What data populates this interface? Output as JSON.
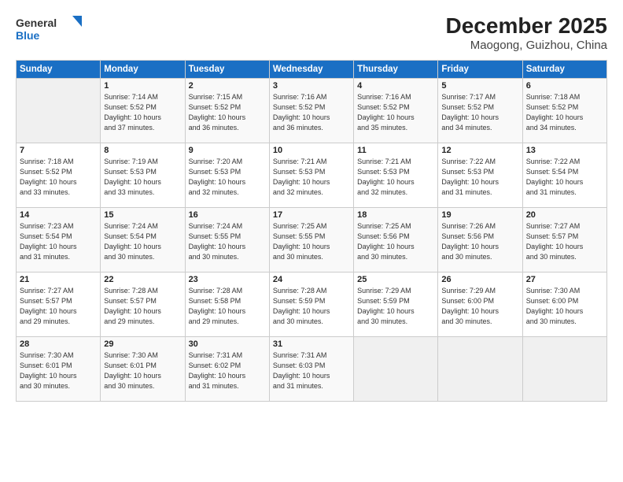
{
  "header": {
    "logo_general": "General",
    "logo_blue": "Blue",
    "title": "December 2025",
    "subtitle": "Maogong, Guizhou, China"
  },
  "weekdays": [
    "Sunday",
    "Monday",
    "Tuesday",
    "Wednesday",
    "Thursday",
    "Friday",
    "Saturday"
  ],
  "weeks": [
    [
      {
        "day": "",
        "info": ""
      },
      {
        "day": "1",
        "info": "Sunrise: 7:14 AM\nSunset: 5:52 PM\nDaylight: 10 hours\nand 37 minutes."
      },
      {
        "day": "2",
        "info": "Sunrise: 7:15 AM\nSunset: 5:52 PM\nDaylight: 10 hours\nand 36 minutes."
      },
      {
        "day": "3",
        "info": "Sunrise: 7:16 AM\nSunset: 5:52 PM\nDaylight: 10 hours\nand 36 minutes."
      },
      {
        "day": "4",
        "info": "Sunrise: 7:16 AM\nSunset: 5:52 PM\nDaylight: 10 hours\nand 35 minutes."
      },
      {
        "day": "5",
        "info": "Sunrise: 7:17 AM\nSunset: 5:52 PM\nDaylight: 10 hours\nand 34 minutes."
      },
      {
        "day": "6",
        "info": "Sunrise: 7:18 AM\nSunset: 5:52 PM\nDaylight: 10 hours\nand 34 minutes."
      }
    ],
    [
      {
        "day": "7",
        "info": "Sunrise: 7:18 AM\nSunset: 5:52 PM\nDaylight: 10 hours\nand 33 minutes."
      },
      {
        "day": "8",
        "info": "Sunrise: 7:19 AM\nSunset: 5:53 PM\nDaylight: 10 hours\nand 33 minutes."
      },
      {
        "day": "9",
        "info": "Sunrise: 7:20 AM\nSunset: 5:53 PM\nDaylight: 10 hours\nand 32 minutes."
      },
      {
        "day": "10",
        "info": "Sunrise: 7:21 AM\nSunset: 5:53 PM\nDaylight: 10 hours\nand 32 minutes."
      },
      {
        "day": "11",
        "info": "Sunrise: 7:21 AM\nSunset: 5:53 PM\nDaylight: 10 hours\nand 32 minutes."
      },
      {
        "day": "12",
        "info": "Sunrise: 7:22 AM\nSunset: 5:53 PM\nDaylight: 10 hours\nand 31 minutes."
      },
      {
        "day": "13",
        "info": "Sunrise: 7:22 AM\nSunset: 5:54 PM\nDaylight: 10 hours\nand 31 minutes."
      }
    ],
    [
      {
        "day": "14",
        "info": "Sunrise: 7:23 AM\nSunset: 5:54 PM\nDaylight: 10 hours\nand 31 minutes."
      },
      {
        "day": "15",
        "info": "Sunrise: 7:24 AM\nSunset: 5:54 PM\nDaylight: 10 hours\nand 30 minutes."
      },
      {
        "day": "16",
        "info": "Sunrise: 7:24 AM\nSunset: 5:55 PM\nDaylight: 10 hours\nand 30 minutes."
      },
      {
        "day": "17",
        "info": "Sunrise: 7:25 AM\nSunset: 5:55 PM\nDaylight: 10 hours\nand 30 minutes."
      },
      {
        "day": "18",
        "info": "Sunrise: 7:25 AM\nSunset: 5:56 PM\nDaylight: 10 hours\nand 30 minutes."
      },
      {
        "day": "19",
        "info": "Sunrise: 7:26 AM\nSunset: 5:56 PM\nDaylight: 10 hours\nand 30 minutes."
      },
      {
        "day": "20",
        "info": "Sunrise: 7:27 AM\nSunset: 5:57 PM\nDaylight: 10 hours\nand 30 minutes."
      }
    ],
    [
      {
        "day": "21",
        "info": "Sunrise: 7:27 AM\nSunset: 5:57 PM\nDaylight: 10 hours\nand 29 minutes."
      },
      {
        "day": "22",
        "info": "Sunrise: 7:28 AM\nSunset: 5:57 PM\nDaylight: 10 hours\nand 29 minutes."
      },
      {
        "day": "23",
        "info": "Sunrise: 7:28 AM\nSunset: 5:58 PM\nDaylight: 10 hours\nand 29 minutes."
      },
      {
        "day": "24",
        "info": "Sunrise: 7:28 AM\nSunset: 5:59 PM\nDaylight: 10 hours\nand 30 minutes."
      },
      {
        "day": "25",
        "info": "Sunrise: 7:29 AM\nSunset: 5:59 PM\nDaylight: 10 hours\nand 30 minutes."
      },
      {
        "day": "26",
        "info": "Sunrise: 7:29 AM\nSunset: 6:00 PM\nDaylight: 10 hours\nand 30 minutes."
      },
      {
        "day": "27",
        "info": "Sunrise: 7:30 AM\nSunset: 6:00 PM\nDaylight: 10 hours\nand 30 minutes."
      }
    ],
    [
      {
        "day": "28",
        "info": "Sunrise: 7:30 AM\nSunset: 6:01 PM\nDaylight: 10 hours\nand 30 minutes."
      },
      {
        "day": "29",
        "info": "Sunrise: 7:30 AM\nSunset: 6:01 PM\nDaylight: 10 hours\nand 30 minutes."
      },
      {
        "day": "30",
        "info": "Sunrise: 7:31 AM\nSunset: 6:02 PM\nDaylight: 10 hours\nand 31 minutes."
      },
      {
        "day": "31",
        "info": "Sunrise: 7:31 AM\nSunset: 6:03 PM\nDaylight: 10 hours\nand 31 minutes."
      },
      {
        "day": "",
        "info": ""
      },
      {
        "day": "",
        "info": ""
      },
      {
        "day": "",
        "info": ""
      }
    ]
  ]
}
